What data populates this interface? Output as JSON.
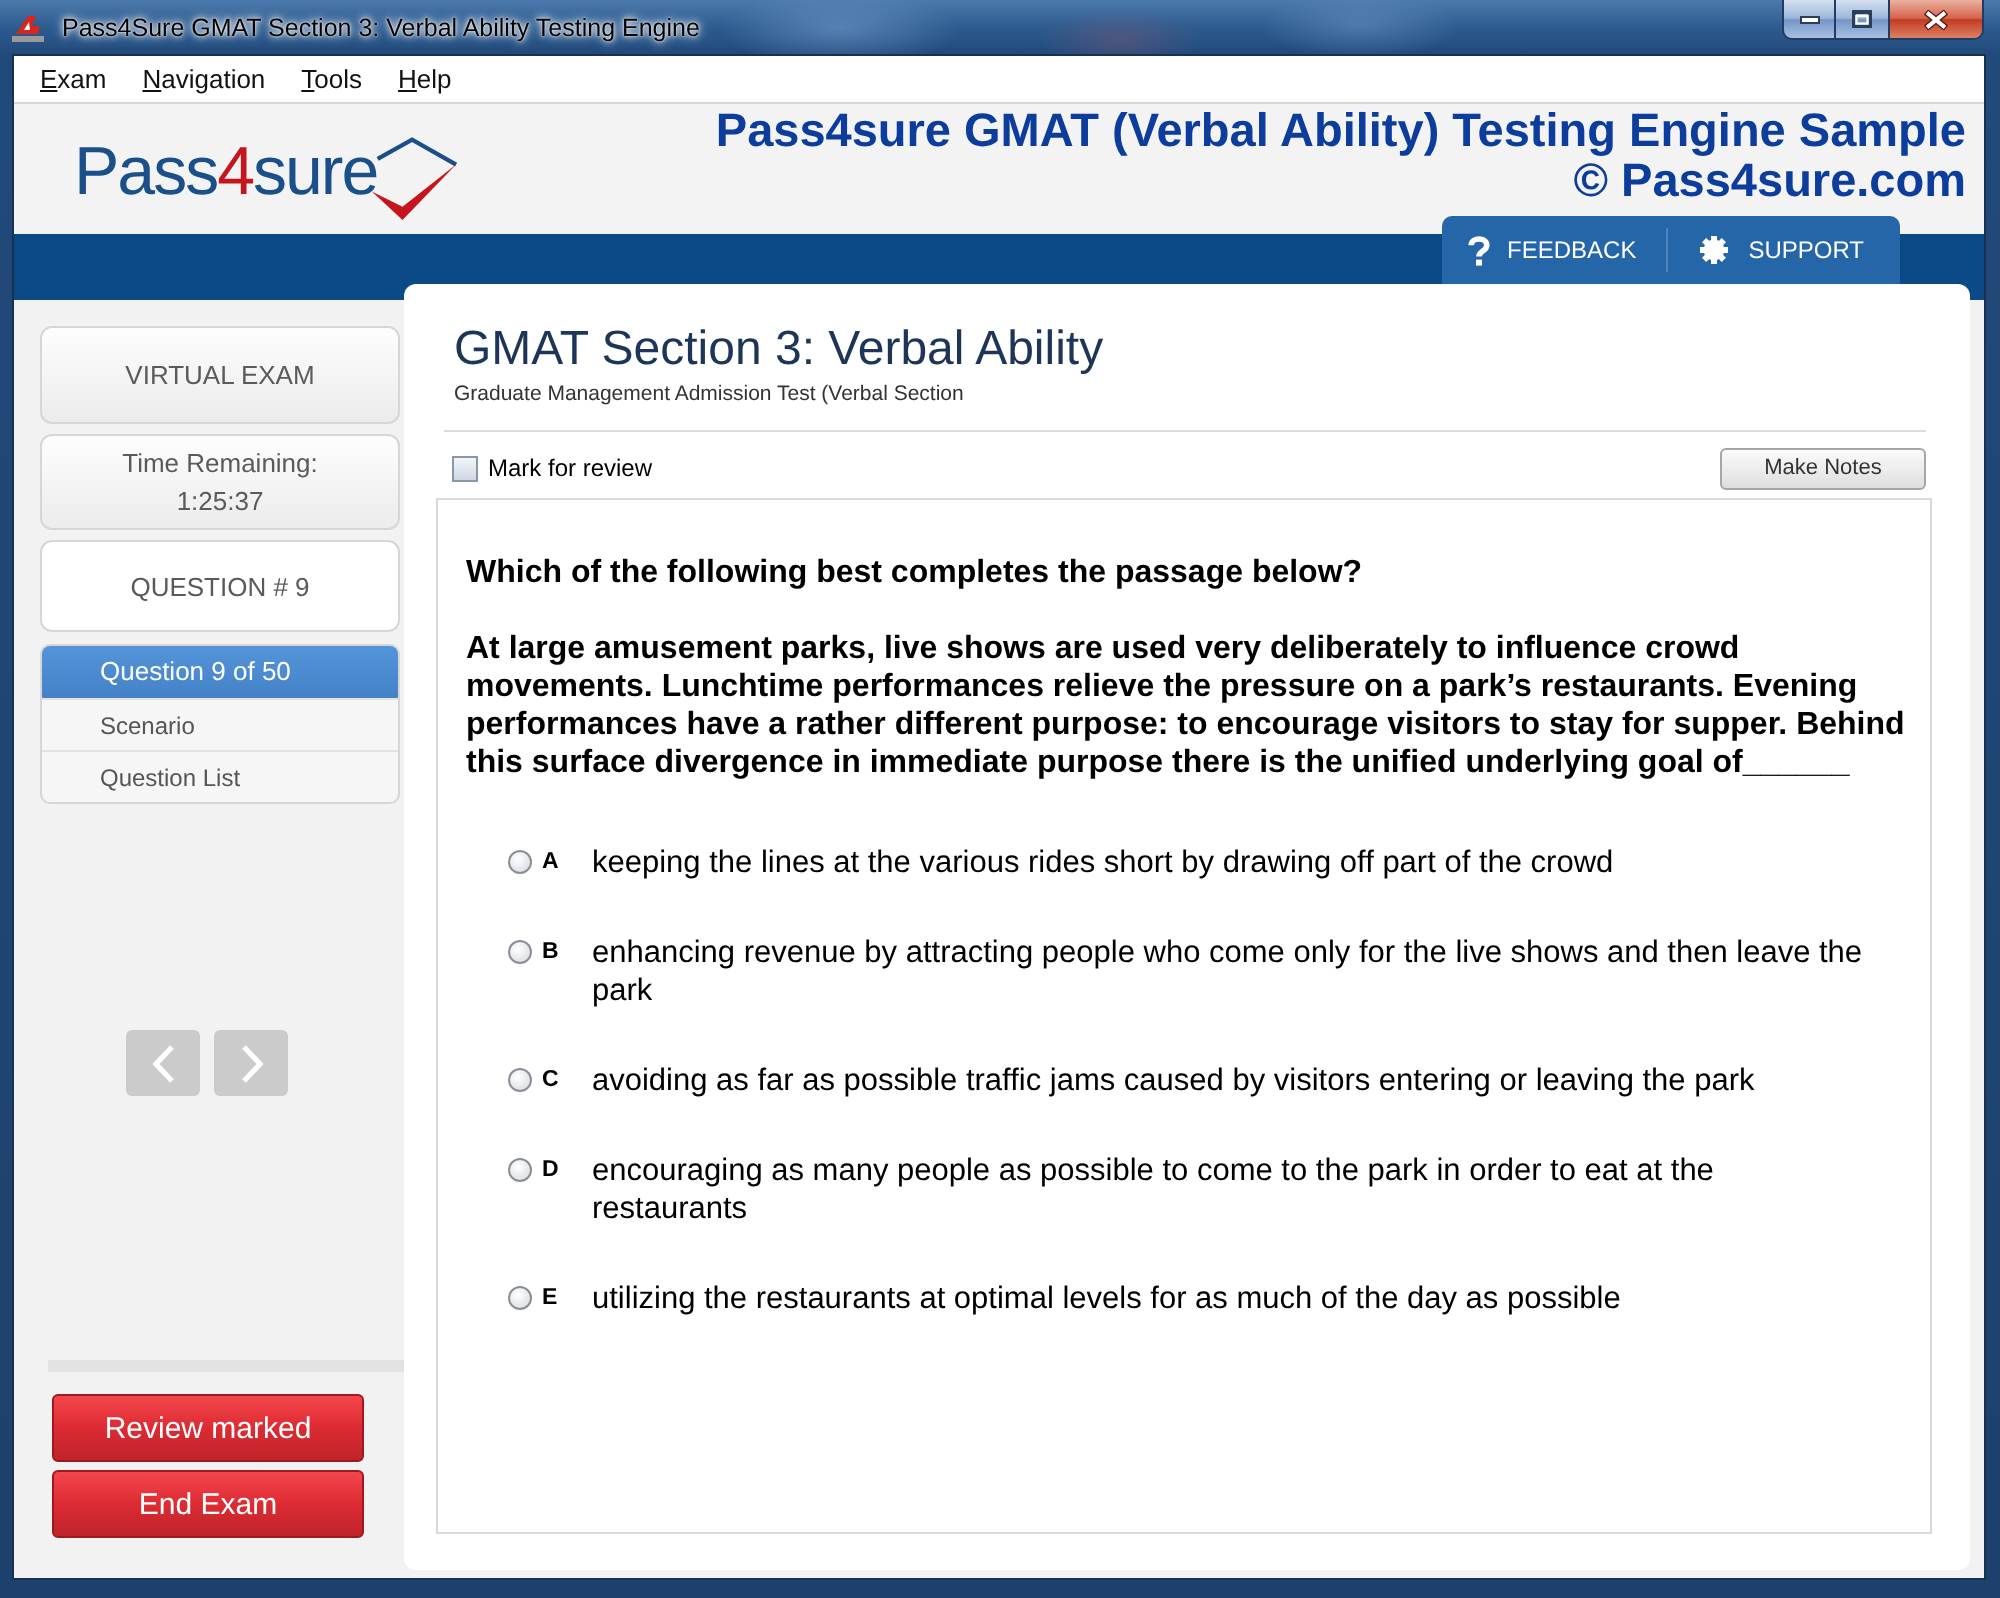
{
  "window": {
    "title": "Pass4Sure GMAT Section 3: Verbal Ability Testing Engine"
  },
  "menu": [
    {
      "label": "Exam"
    },
    {
      "label": "Navigation"
    },
    {
      "label": "Tools"
    },
    {
      "label": "Help"
    }
  ],
  "header": {
    "logo": [
      {
        "text": "Pass",
        "color": "#1b4f8a"
      },
      {
        "text": "4",
        "color": "#c4161c"
      },
      {
        "text": "sure",
        "color": "#1b4f8a"
      }
    ],
    "title": "Pass4sure GMAT (Verbal Ability) Testing Engine Sample",
    "copyright": "© Pass4sure.com"
  },
  "top_links": [
    {
      "kind": "help",
      "label": "FEEDBACK"
    },
    {
      "kind": "settings",
      "label": "SUPPORT"
    }
  ],
  "sidebar": {
    "mode": "VIRTUAL EXAM",
    "timer": {
      "label": "Time Remaining:",
      "value": "1:25:37"
    },
    "question_number": "QUESTION # 9",
    "nav": [
      {
        "label": "Question 9 of 50",
        "selected": true
      },
      {
        "label": "Scenario",
        "selected": false
      },
      {
        "label": "Question List",
        "selected": false
      }
    ],
    "buttons": [
      "Review marked",
      "End Exam"
    ]
  },
  "section": {
    "title": "GMAT Section 3: Verbal Ability",
    "subtitle": "Graduate Management Admission Test (Verbal Section"
  },
  "mark_for_review": {
    "label": "Mark for review",
    "checked": false
  },
  "notes_button": "Make Notes",
  "question": {
    "prompt": "Which of the following best completes the passage below?",
    "passage": "At large amusement parks, live shows are used very deliberately to influence crowd movements. Lunchtime performances relieve the pressure on a park’s restaurants. Evening performances have a rather different purpose: to encourage visitors to stay for supper. Behind this surface divergence in immediate purpose there is the unified underlying goal of______",
    "options": [
      {
        "letter": "A",
        "text": "keeping the lines at the various rides short by drawing off part of the crowd",
        "selected": false
      },
      {
        "letter": "B",
        "text": "enhancing revenue by attracting people who come only for the live shows and then leave the park",
        "selected": false
      },
      {
        "letter": "C",
        "text": "avoiding as far as possible traffic jams caused by visitors entering or leaving the park",
        "selected": false
      },
      {
        "letter": "D",
        "text": "encouraging as many people as possible to come to the park in order to eat at the restaurants",
        "selected": false
      },
      {
        "letter": "E",
        "text": "utilizing the restaurants at optimal levels for as much of the day as possible",
        "selected": false
      }
    ]
  }
}
